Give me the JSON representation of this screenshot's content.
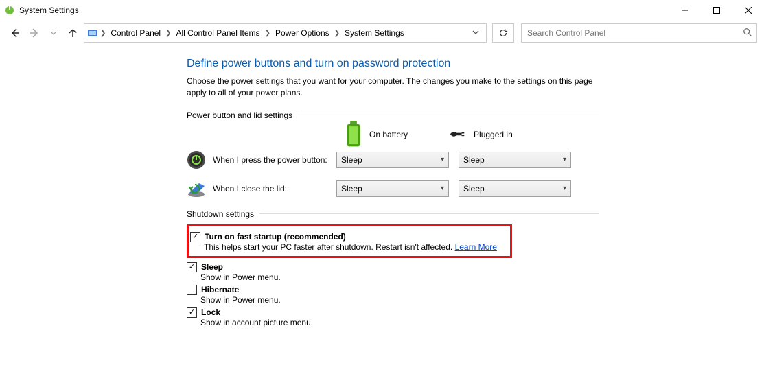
{
  "window": {
    "title": "System Settings"
  },
  "breadcrumb": {
    "items": [
      "Control Panel",
      "All Control Panel Items",
      "Power Options",
      "System Settings"
    ]
  },
  "search": {
    "placeholder": "Search Control Panel"
  },
  "page": {
    "title": "Define power buttons and turn on password protection",
    "desc": "Choose the power settings that you want for your computer. The changes you make to the settings on this page apply to all of your power plans."
  },
  "section_power": {
    "heading": "Power button and lid settings",
    "cols": {
      "battery": "On battery",
      "plugged": "Plugged in"
    },
    "rows": [
      {
        "label": "When I press the power button:",
        "battery": "Sleep",
        "plugged": "Sleep"
      },
      {
        "label": "When I close the lid:",
        "battery": "Sleep",
        "plugged": "Sleep"
      }
    ]
  },
  "section_shutdown": {
    "heading": "Shutdown settings",
    "items": [
      {
        "label": "Turn on fast startup (recommended)",
        "checked": true,
        "desc": "This helps start your PC faster after shutdown. Restart isn't affected. ",
        "link": "Learn More"
      },
      {
        "label": "Sleep",
        "checked": true,
        "desc": "Show in Power menu."
      },
      {
        "label": "Hibernate",
        "checked": false,
        "desc": "Show in Power menu."
      },
      {
        "label": "Lock",
        "checked": true,
        "desc": "Show in account picture menu."
      }
    ]
  }
}
